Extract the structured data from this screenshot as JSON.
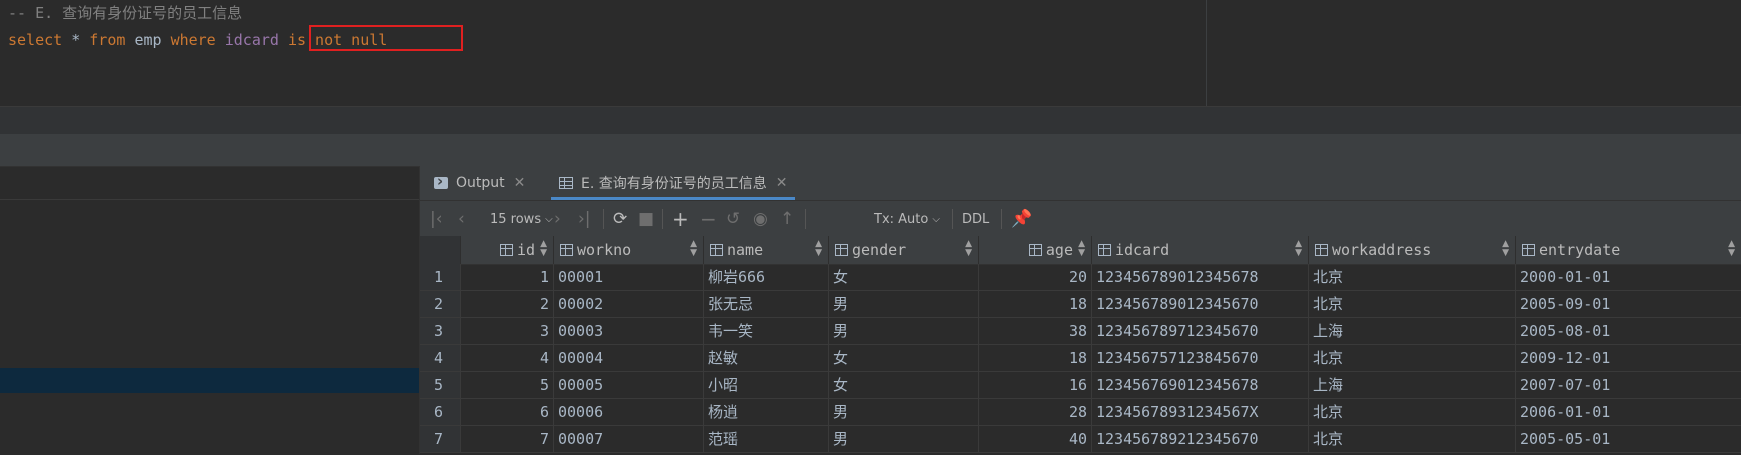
{
  "editor": {
    "comment": "-- E. 查询有身份证号的员工信息",
    "sql": {
      "select": "select",
      "star": "*",
      "from": "from",
      "table": "emp",
      "where": "where",
      "column": "idcard",
      "condition": "is not null"
    }
  },
  "results": {
    "tabs": [
      {
        "label": "Output",
        "icon": "terminal-icon"
      },
      {
        "label": "E. 查询有身份证号的员工信息",
        "icon": "table-icon"
      }
    ],
    "toolbar": {
      "rows_label": "15 rows",
      "tx_label": "Tx: Auto",
      "ddl_label": "DDL"
    },
    "columns": [
      "id",
      "workno",
      "name",
      "gender",
      "age",
      "idcard",
      "workaddress",
      "entrydate"
    ],
    "rows": [
      {
        "rownum": "1",
        "id": "1",
        "workno": "00001",
        "name": "柳岩666",
        "gender": "女",
        "age": "20",
        "idcard": "123456789012345678",
        "workaddress": "北京",
        "entrydate": "2000-01-01"
      },
      {
        "rownum": "2",
        "id": "2",
        "workno": "00002",
        "name": "张无忌",
        "gender": "男",
        "age": "18",
        "idcard": "123456789012345670",
        "workaddress": "北京",
        "entrydate": "2005-09-01"
      },
      {
        "rownum": "3",
        "id": "3",
        "workno": "00003",
        "name": "韦一笑",
        "gender": "男",
        "age": "38",
        "idcard": "123456789712345670",
        "workaddress": "上海",
        "entrydate": "2005-08-01"
      },
      {
        "rownum": "4",
        "id": "4",
        "workno": "00004",
        "name": "赵敏",
        "gender": "女",
        "age": "18",
        "idcard": "123456757123845670",
        "workaddress": "北京",
        "entrydate": "2009-12-01"
      },
      {
        "rownum": "5",
        "id": "5",
        "workno": "00005",
        "name": "小昭",
        "gender": "女",
        "age": "16",
        "idcard": "123456769012345678",
        "workaddress": "上海",
        "entrydate": "2007-07-01"
      },
      {
        "rownum": "6",
        "id": "6",
        "workno": "00006",
        "name": "杨逍",
        "gender": "男",
        "age": "28",
        "idcard": "12345678931234567X",
        "workaddress": "北京",
        "entrydate": "2006-01-01"
      },
      {
        "rownum": "7",
        "id": "7",
        "workno": "00007",
        "name": "范瑶",
        "gender": "男",
        "age": "40",
        "idcard": "123456789212345670",
        "workaddress": "北京",
        "entrydate": "2005-05-01"
      }
    ]
  },
  "colors": {
    "keyword": "#cc7832",
    "comment": "#808080",
    "column": "#9876aa",
    "highlight_box": "#e02020",
    "selection_band": "#0d293e",
    "active_tab_underline": "#4a88c7"
  }
}
